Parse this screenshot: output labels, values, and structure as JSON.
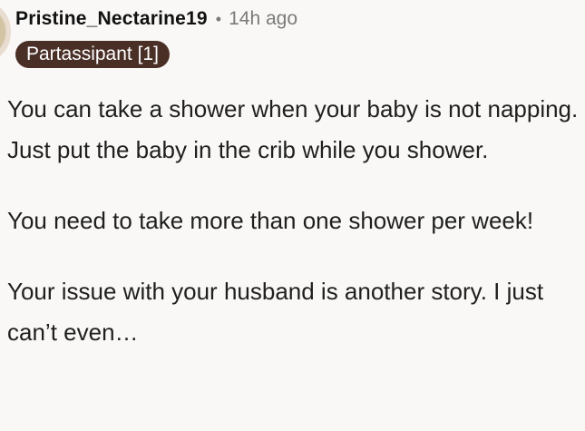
{
  "comment": {
    "username": "Pristine_Nectarine19",
    "separator": "•",
    "timestamp": "14h ago",
    "flair": "Partassipant [1]",
    "paragraphs": [
      "You can take a shower when your baby is not napping. Just put the baby in the crib while you shower.",
      "You need to take more than one shower per week!",
      "Your issue with  your husband is another story. I just can’t even…"
    ]
  }
}
